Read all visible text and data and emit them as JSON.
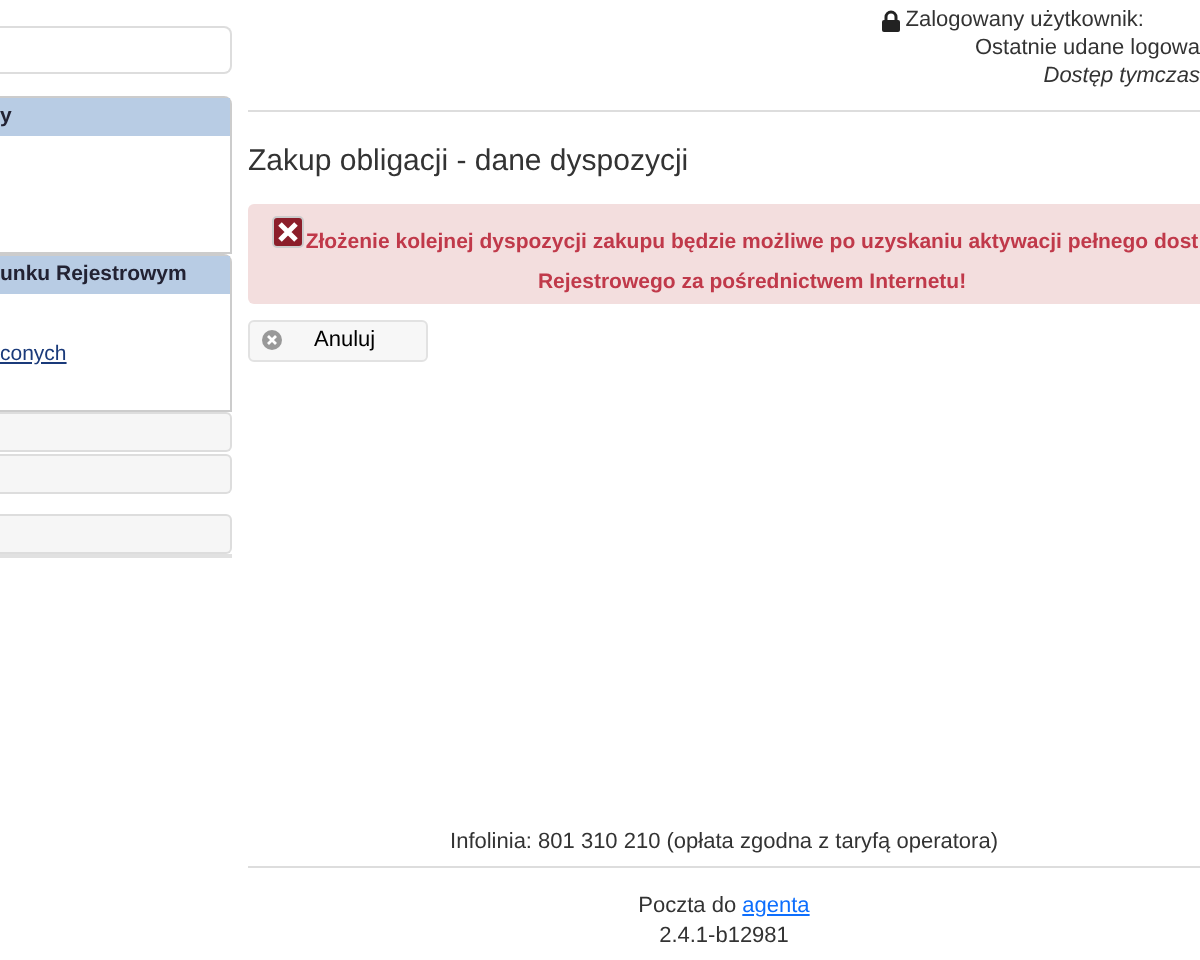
{
  "sidebar": {
    "panels": [
      {
        "header": "y"
      },
      {
        "header": "unku Rejestrowym",
        "links": [
          "conych"
        ]
      }
    ]
  },
  "user_info": {
    "logged_in_label": "Zalogowany użytkownik:",
    "last_login": "Ostatnie udane logowa",
    "access": "Dostęp tymczas"
  },
  "page_title": "Zakup obligacji - dane dyspozycji",
  "alert": {
    "lines": [
      "Złożenie kolejnej dyspozycji zakupu będzie możliwe po uzyskaniu aktywacji pełnego dost",
      "Rejestrowego za pośrednictwem Internetu!"
    ]
  },
  "buttons": [
    {
      "label": "Anuluj"
    }
  ],
  "footer": {
    "hotline": "Infolinia: 801 310 210 (opłata zgodna z taryfą operatora)",
    "mail_prefix": "Poczta do",
    "mail_link": "agenta",
    "version": "2.4.1-b12981"
  }
}
